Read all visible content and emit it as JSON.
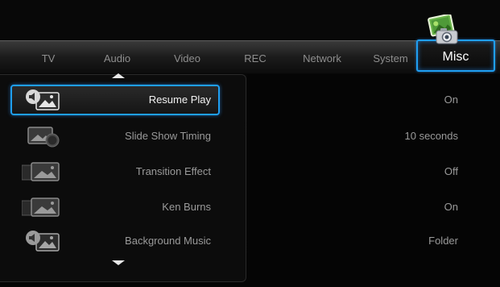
{
  "tabs": [
    {
      "label": "TV"
    },
    {
      "label": "Audio"
    },
    {
      "label": "Video"
    },
    {
      "label": "REC"
    },
    {
      "label": "Network"
    },
    {
      "label": "System"
    },
    {
      "label": "Misc",
      "active": true
    }
  ],
  "settings": [
    {
      "label": "Resume Play",
      "value": "On",
      "icon": "speaker-photo-icon",
      "selected": true
    },
    {
      "label": "Slide Show Timing",
      "value": "10 seconds",
      "icon": "photo-timer-icon"
    },
    {
      "label": "Transition Effect",
      "value": "Off",
      "icon": "photo-transition-icon"
    },
    {
      "label": "Ken Burns",
      "value": "On",
      "icon": "photo-transition-icon"
    },
    {
      "label": "Background Music",
      "value": "Folder",
      "icon": "speaker-photo-icon"
    }
  ],
  "colors": {
    "accent": "#1f9ff2",
    "text_dim": "#9a9a9a",
    "text_active": "#ffffff"
  }
}
